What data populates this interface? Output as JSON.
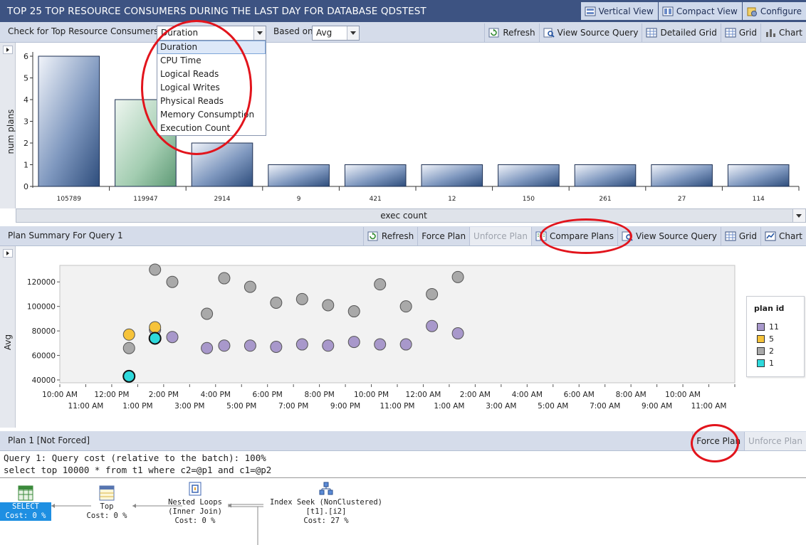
{
  "window": {
    "title": "TOP 25 TOP RESOURCE CONSUMERS DURING THE LAST DAY FOR DATABASE QDSTEST",
    "view_buttons": [
      "Vertical View",
      "Compact View",
      "Configure"
    ]
  },
  "filter_bar": {
    "check_label": "Check for Top Resource Consumers in",
    "metric_selected": "Duration",
    "based_on_label": "Based on",
    "based_on_selected": "Avg",
    "buttons": [
      "Refresh",
      "View Source Query",
      "Detailed Grid",
      "Grid",
      "Chart"
    ]
  },
  "metric_dropdown": {
    "options": [
      "Duration",
      "CPU Time",
      "Logical Reads",
      "Logical Writes",
      "Physical Reads",
      "Memory Consumption",
      "Execution Count"
    ]
  },
  "top_chart": {
    "ylabel": "num plans",
    "xlabel": "exec count"
  },
  "plan_summary": {
    "title": "Plan Summary For Query 1",
    "buttons": [
      "Refresh",
      "Force Plan",
      "Unforce Plan",
      "Compare Plans",
      "View Source Query",
      "Grid",
      "Chart"
    ],
    "ylabel": "Avg",
    "legend_title": "plan id"
  },
  "plan_bar": {
    "title": "Plan 1 [Not Forced]",
    "force": "Force Plan",
    "unforce": "Unforce Plan"
  },
  "query_text": {
    "line1": "Query 1: Query cost (relative to the batch): 100%",
    "line2": "select top 10000 * from t1 where c2=@p1 and c1=@p2"
  },
  "plan_nodes": [
    {
      "name": "SELECT",
      "cost": "Cost: 0 %"
    },
    {
      "name": "Top",
      "cost": "Cost: 0 %"
    },
    {
      "name": "Nested Loops",
      "sub": "(Inner Join)",
      "cost": "Cost: 0 %"
    },
    {
      "name": "Index Seek (NonClustered)",
      "sub": "[t1].[i2]",
      "cost": "Cost: 27 %"
    }
  ],
  "colors": {
    "titlebar": "#3d5382",
    "plan11": "#a898cb",
    "plan5": "#f6c33a",
    "plan2": "#a9a9a9",
    "plan1": "#2ed9dc",
    "annotation": "#e2141c"
  },
  "chart_data": [
    {
      "type": "bar",
      "categories": [
        "105789",
        "119947",
        "2914",
        "9",
        "421",
        "12",
        "150",
        "261",
        "27",
        "114"
      ],
      "values": [
        6,
        4,
        2,
        1,
        1,
        1,
        1,
        1,
        1,
        1
      ],
      "highlight_index": 1,
      "xlabel": "exec count",
      "ylabel": "num plans",
      "ylim": [
        0,
        6
      ],
      "yticks": [
        "0",
        "1",
        "2",
        "3",
        "4",
        "5",
        "6"
      ]
    },
    {
      "type": "scatter",
      "ylabel": "Avg",
      "ylim": [
        40000,
        130000
      ],
      "yticks": [
        "40000",
        "60000",
        "80000",
        "100000",
        "120000"
      ],
      "x_ticks_upper": [
        "10:00 AM",
        "12:00 PM",
        "2:00 PM",
        "4:00 PM",
        "6:00 PM",
        "8:00 PM",
        "10:00 PM",
        "12:00 AM",
        "2:00 AM",
        "4:00 AM",
        "6:00 AM",
        "8:00 AM",
        "10:00 AM"
      ],
      "x_ticks_lower": [
        "11:00 AM",
        "1:00 PM",
        "3:00 PM",
        "5:00 PM",
        "7:00 PM",
        "9:00 PM",
        "11:00 PM",
        "1:00 AM",
        "3:00 AM",
        "5:00 AM",
        "7:00 AM",
        "9:00 AM",
        "11:00 AM"
      ],
      "xlim": [
        "10:00 AM",
        "12:00 PM"
      ],
      "legend": "right",
      "series": [
        {
          "name": "11",
          "color": "#a898cb",
          "points": [
            [
              "1:40 PM",
              81000
            ],
            [
              "2:20 PM",
              75000
            ],
            [
              "3:40 PM",
              66000
            ],
            [
              "4:20 PM",
              68000
            ],
            [
              "5:20 PM",
              68000
            ],
            [
              "6:20 PM",
              67000
            ],
            [
              "7:20 PM",
              69000
            ],
            [
              "8:20 PM",
              68000
            ],
            [
              "9:20 PM",
              71000
            ],
            [
              "10:20 PM",
              69000
            ],
            [
              "11:20 PM",
              69000
            ],
            [
              "12:20 AM",
              84000
            ],
            [
              "1:20 AM",
              78000
            ]
          ]
        },
        {
          "name": "5",
          "color": "#f6c33a",
          "points": [
            [
              "12:40 PM",
              77000
            ],
            [
              "1:40 PM",
              83000
            ]
          ]
        },
        {
          "name": "2",
          "color": "#a9a9a9",
          "points": [
            [
              "12:40 PM",
              66000
            ],
            [
              "1:40 PM",
              130000
            ],
            [
              "2:20 PM",
              120000
            ],
            [
              "3:40 PM",
              94000
            ],
            [
              "4:20 PM",
              123000
            ],
            [
              "5:20 PM",
              116000
            ],
            [
              "6:20 PM",
              103000
            ],
            [
              "7:20 PM",
              106000
            ],
            [
              "8:20 PM",
              101000
            ],
            [
              "9:20 PM",
              96000
            ],
            [
              "10:20 PM",
              118000
            ],
            [
              "11:20 PM",
              100000
            ],
            [
              "12:20 AM",
              110000
            ],
            [
              "1:20 AM",
              124000
            ]
          ]
        },
        {
          "name": "1",
          "color": "#2ed9dc",
          "points": [
            [
              "12:40 PM",
              43000
            ],
            [
              "1:40 PM",
              74000
            ]
          ]
        }
      ]
    }
  ]
}
